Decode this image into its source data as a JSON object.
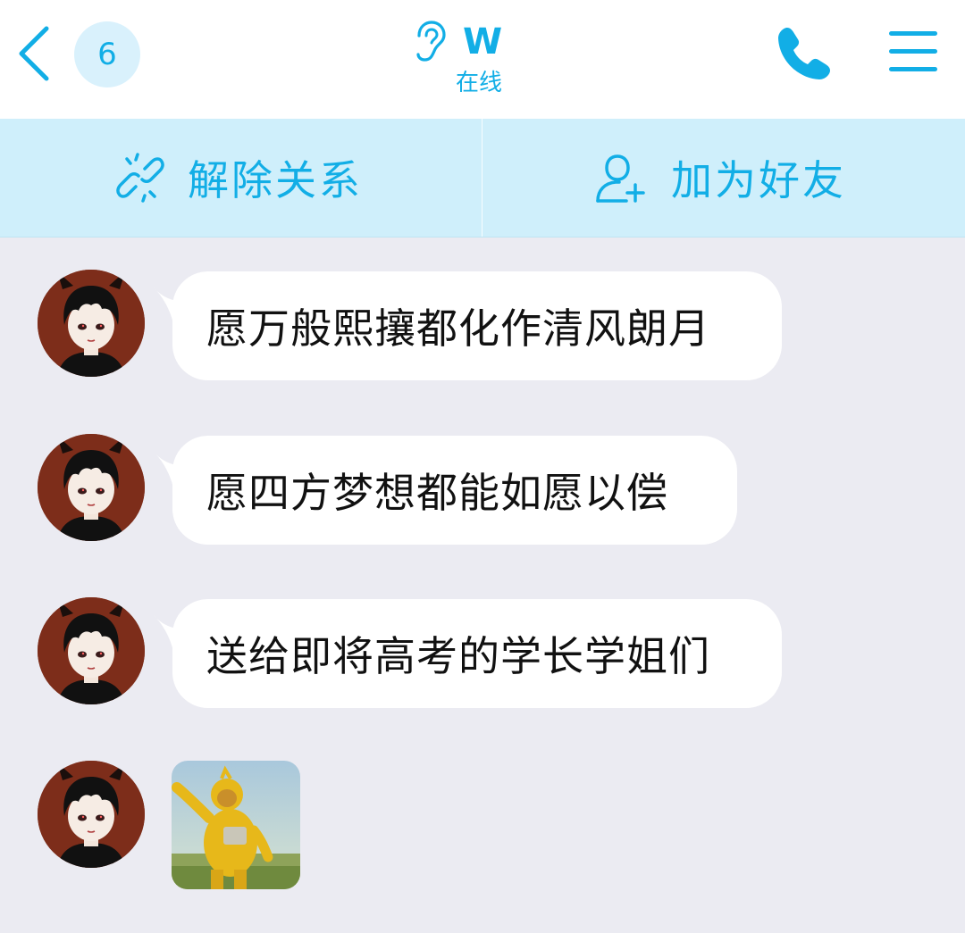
{
  "header": {
    "unread_count": "6",
    "contact_name": "W",
    "status": "在线"
  },
  "actions": {
    "unlink_label": "解除关系",
    "add_friend_label": "加为好友"
  },
  "messages": [
    {
      "type": "text",
      "text": "愿万般熙攘都化作清风朗月"
    },
    {
      "type": "text",
      "text": "愿四方梦想都能如愿以偿"
    },
    {
      "type": "text",
      "text": "送给即将高考的学长学姐们"
    },
    {
      "type": "sticker",
      "sticker": "teletubby-sticker"
    }
  ],
  "colors": {
    "accent": "#12aee6",
    "action_bar": "#cfeffb",
    "chat_background": "#ebebf2",
    "bubble": "#ffffff"
  }
}
